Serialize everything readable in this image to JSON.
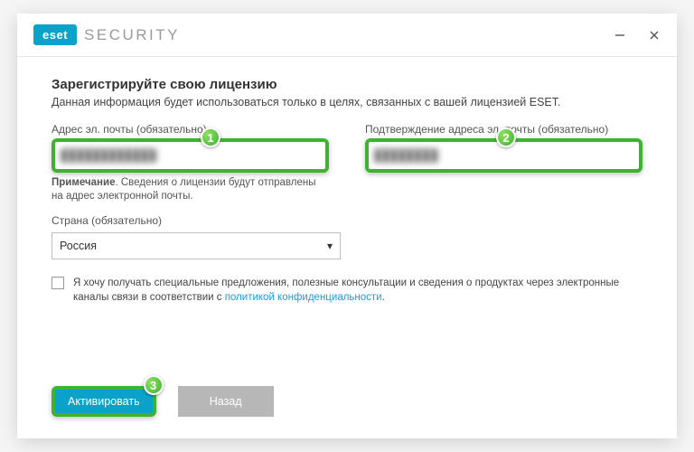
{
  "brand": {
    "badge": "eset",
    "product": "SECURITY"
  },
  "heading": "Зарегистрируйте свою лицензию",
  "subtitle": "Данная информация будет использоваться только в целях, связанных с вашей лицензией ESET.",
  "email": {
    "label": "Адрес эл. почты (обязательно)",
    "value": "████████████"
  },
  "confirm": {
    "label": "Подтверждение адреса эл. почты (обязательно)",
    "value": "████████"
  },
  "note_prefix": "Примечание",
  "note_text": ". Сведения о лицензии будут отправлены на адрес электронной почты.",
  "country": {
    "label": "Страна (обязательно)",
    "value": "Россия"
  },
  "consent_text": "Я хочу получать специальные предложения, полезные консультации и сведения о продуктах через электронные каналы связи в соответствии с ",
  "consent_link": "политикой конфиденциальности",
  "consent_suffix": ".",
  "buttons": {
    "activate": "Активировать",
    "back": "Назад"
  },
  "badges": {
    "n1": "1",
    "n2": "2",
    "n3": "3"
  }
}
